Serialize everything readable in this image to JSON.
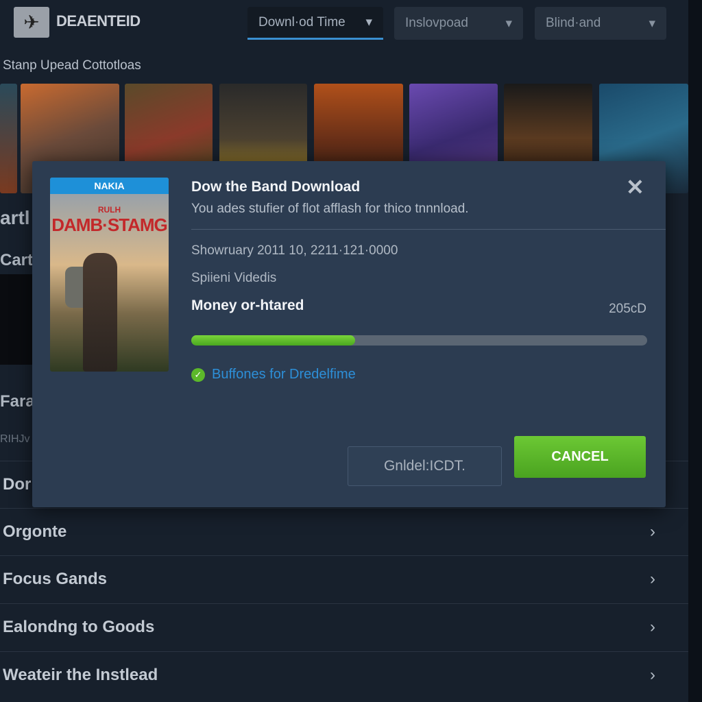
{
  "header": {
    "brand": "DEAENTEID",
    "dropdowns": [
      {
        "label": "Downl·od Time",
        "active": true
      },
      {
        "label": "Inslovpoad"
      },
      {
        "label": "Blind·and"
      }
    ]
  },
  "section_title": "Stanp Upead Cottotloas",
  "side_labels": [
    "artl",
    "Carte",
    "Fara",
    "RIHJv"
  ],
  "list": [
    {
      "label": "Dor"
    },
    {
      "label": "Orgonte"
    },
    {
      "label": "Focus Gands"
    },
    {
      "label": "Ealondng to Goods"
    },
    {
      "label": "Weateir the Instlead"
    }
  ],
  "dialog": {
    "poster": {
      "band": "NAKIA",
      "subtitle": "RULH",
      "title": "DAMB·STAMG"
    },
    "title": "Dow the Band Download",
    "subtitle": "You ades stufier of flot afflash for thico tnnnload.",
    "date": "Showruary 2011 10, 2211·121·0000",
    "type": "Spiieni Videdis",
    "item_name": "Money or-htared",
    "size": "205cD",
    "progress_percent": 36,
    "status": "Buffones for Dredelfime",
    "secondary_button": "Gnldel:ICDT.",
    "cancel_button": "CANCEL",
    "close_icon": "close-icon"
  },
  "colors": {
    "accent": "#3a8fd0",
    "progress": "#5cb82a",
    "status": "#2d8fd8",
    "cancel": "#5cb32a"
  }
}
